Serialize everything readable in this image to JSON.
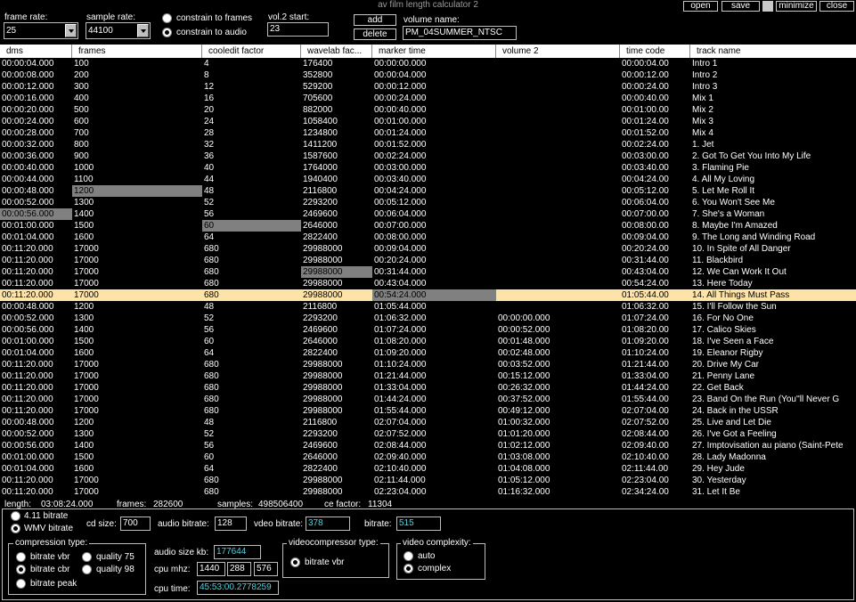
{
  "window": {
    "title": "av film length calculator 2",
    "buttons": {
      "open": "open",
      "save": "save",
      "minimize": "minimize",
      "close": "close"
    }
  },
  "toolbar": {
    "frame_rate_label": "frame rate:",
    "frame_rate_value": "25",
    "sample_rate_label": "sample rate:",
    "sample_rate_value": "44100",
    "constrain_frames": "constrain to frames",
    "constrain_audio": "constrain to audio",
    "vol2_start_label": "vol.2 start:",
    "vol2_start_value": "23",
    "add": "add",
    "delete": "delete",
    "volume_name_label": "volume name:",
    "volume_name_value": "PM_04SUMMER_NTSC"
  },
  "table": {
    "columns": [
      "dms",
      "frames",
      "cooledit factor",
      "wavelab fac...",
      "marker time",
      "volume 2",
      "time code",
      "track name"
    ],
    "rows": [
      [
        "00:00:04.000",
        "100",
        "4",
        "176400",
        "00:00:00.000",
        "",
        "00:00:04.00",
        "Intro 1"
      ],
      [
        "00:00:08.000",
        "200",
        "8",
        "352800",
        "00:00:04.000",
        "",
        "00:00:12.00",
        "Intro 2"
      ],
      [
        "00:00:12.000",
        "300",
        "12",
        "529200",
        "00:00:12.000",
        "",
        "00:00:24.00",
        "Intro 3"
      ],
      [
        "00:00:16.000",
        "400",
        "16",
        "705600",
        "00:00:24.000",
        "",
        "00:00:40.00",
        "Mix 1"
      ],
      [
        "00:00:20.000",
        "500",
        "20",
        "882000",
        "00:00:40.000",
        "",
        "00:01:00.00",
        "Mix 2"
      ],
      [
        "00:00:24.000",
        "600",
        "24",
        "1058400",
        "00:01:00.000",
        "",
        "00:01:24.00",
        "Mix 3"
      ],
      [
        "00:00:28.000",
        "700",
        "28",
        "1234800",
        "00:01:24.000",
        "",
        "00:01:52.00",
        "Mix 4"
      ],
      [
        "00:00:32.000",
        "800",
        "32",
        "1411200",
        "00:01:52.000",
        "",
        "00:02:24.00",
        "1. Jet"
      ],
      [
        "00:00:36.000",
        "900",
        "36",
        "1587600",
        "00:02:24.000",
        "",
        "00:03:00.00",
        "2. Got To Get You Into My Life"
      ],
      [
        "00:00:40.000",
        "1000",
        "40",
        "1764000",
        "00:03:00.000",
        "",
        "00:03:40.00",
        "3. Flaming Pie"
      ],
      [
        "00:00:44.000",
        "1100",
        "44",
        "1940400",
        "00:03:40.000",
        "",
        "00:04:24.00",
        "4. All My Loving"
      ],
      [
        "00:00:48.000",
        "1200",
        "48",
        "2116800",
        "00:04:24.000",
        "",
        "00:05:12.00",
        "5. Let Me Roll It"
      ],
      [
        "00:00:52.000",
        "1300",
        "52",
        "2293200",
        "00:05:12.000",
        "",
        "00:06:04.00",
        "6. You Won't See Me"
      ],
      [
        "00:00:56.000",
        "1400",
        "56",
        "2469600",
        "00:06:04.000",
        "",
        "00:07:00.00",
        "7. She's a Woman"
      ],
      [
        "00:01:00.000",
        "1500",
        "60",
        "2646000",
        "00:07:00.000",
        "",
        "00:08:00.00",
        "8. Maybe I'm Amazed"
      ],
      [
        "00:01:04.000",
        "1600",
        "64",
        "2822400",
        "00:08:00.000",
        "",
        "00:09:04.00",
        "9. The Long and Winding Road"
      ],
      [
        "00:11:20.000",
        "17000",
        "680",
        "29988000",
        "00:09:04.000",
        "",
        "00:20:24.00",
        "10. In Spite of All Danger"
      ],
      [
        "00:11:20.000",
        "17000",
        "680",
        "29988000",
        "00:20:24.000",
        "",
        "00:31:44.00",
        "11. Blackbird"
      ],
      [
        "00:11:20.000",
        "17000",
        "680",
        "29988000",
        "00:31:44.000",
        "",
        "00:43:04.00",
        "12.  We Can Work It Out"
      ],
      [
        "00:11:20.000",
        "17000",
        "680",
        "29988000",
        "00:43:04.000",
        "",
        "00:54:24.00",
        "13. Here Today"
      ],
      [
        "00:11:20.000",
        "17000",
        "680",
        "29988000",
        "00:54:24.000",
        "",
        "01:05:44.00",
        "14. All Things Must Pass"
      ],
      [
        "00:00:48.000",
        "1200",
        "48",
        "2116800",
        "01:05:44.000",
        "",
        "01:06:32.00",
        "15. I'll Follow the Sun"
      ],
      [
        "00:00:52.000",
        "1300",
        "52",
        "2293200",
        "01:06:32.000",
        "00:00:00.000",
        "01:07:24.00",
        "16. For No One"
      ],
      [
        "00:00:56.000",
        "1400",
        "56",
        "2469600",
        "01:07:24.000",
        "00:00:52.000",
        "01:08:20.00",
        "17. Calico Skies"
      ],
      [
        "00:01:00.000",
        "1500",
        "60",
        "2646000",
        "01:08:20.000",
        "00:01:48.000",
        "01:09:20.00",
        "18. I've Seen a Face"
      ],
      [
        "00:01:04.000",
        "1600",
        "64",
        "2822400",
        "01:09:20.000",
        "00:02:48.000",
        "01:10:24.00",
        "19. Eleanor Rigby"
      ],
      [
        "00:11:20.000",
        "17000",
        "680",
        "29988000",
        "01:10:24.000",
        "00:03:52.000",
        "01:21:44.00",
        "20. Drive My Car"
      ],
      [
        "00:11:20.000",
        "17000",
        "680",
        "29988000",
        "01:21:44.000",
        "00:15:12.000",
        "01:33:04.00",
        "21. Penny Lane"
      ],
      [
        "00:11:20.000",
        "17000",
        "680",
        "29988000",
        "01:33:04.000",
        "00:26:32.000",
        "01:44:24.00",
        "22. Get Back"
      ],
      [
        "00:11:20.000",
        "17000",
        "680",
        "29988000",
        "01:44:24.000",
        "00:37:52.000",
        "01:55:44.00",
        "23. Band On the Run (You''ll Never G"
      ],
      [
        "00:11:20.000",
        "17000",
        "680",
        "29988000",
        "01:55:44.000",
        "00:49:12.000",
        "02:07:04.00",
        "24. Back in the USSR"
      ],
      [
        "00:00:48.000",
        "1200",
        "48",
        "2116800",
        "02:07:04.000",
        "01:00:32.000",
        "02:07:52.00",
        "25. Live and Let Die"
      ],
      [
        "00:00:52.000",
        "1300",
        "52",
        "2293200",
        "02:07:52.000",
        "01:01:20.000",
        "02:08:44.00",
        "26. I've Got a Feeling"
      ],
      [
        "00:00:56.000",
        "1400",
        "56",
        "2469600",
        "02:08:44.000",
        "01:02:12.000",
        "02:09:40.00",
        "27. Imptovisation au piano (Saint-Pete"
      ],
      [
        "00:01:00.000",
        "1500",
        "60",
        "2646000",
        "02:09:40.000",
        "01:03:08.000",
        "02:10:40.00",
        "28. Lady Madonna"
      ],
      [
        "00:01:04.000",
        "1600",
        "64",
        "2822400",
        "02:10:40.000",
        "01:04:08.000",
        "02:11:44.00",
        "29. Hey Jude"
      ],
      [
        "00:11:20.000",
        "17000",
        "680",
        "29988000",
        "02:11:44.000",
        "01:05:12.000",
        "02:23:04.00",
        "30. Yesterday"
      ],
      [
        "00:11:20.000",
        "17000",
        "680",
        "29988000",
        "02:23:04.000",
        "01:16:32.000",
        "02:34:24.00",
        "31. Let It Be"
      ]
    ]
  },
  "status": {
    "length_label": "length:",
    "length_value": "03:08:24.000",
    "frames_label": "frames:",
    "frames_value": "282600",
    "samples_label": "samples:",
    "samples_value": "498506400",
    "ce_label": "ce factor:",
    "ce_value": "11304"
  },
  "bottom": {
    "bitrate_411": "4.11 bitrate",
    "wmv_bitrate": "WMV bitrate",
    "cd_size_label": "cd size:",
    "cd_size_value": "700",
    "audio_bitrate_label": "audio bitrate:",
    "audio_bitrate_value": "128",
    "video_bitrate_label": "vdeo bitrate:",
    "video_bitrate_value": "378",
    "bitrate_label": "bitrate:",
    "bitrate_value": "515",
    "compression_title": "compression type:",
    "bitrate_vbr": "bitrate vbr",
    "bitrate_cbr": "bitrate cbr",
    "bitrate_peak": "bitrate peak",
    "quality_75": "quality 75",
    "quality_98": "quality 98",
    "audio_size_label": "audio size kb:",
    "audio_size_value": "177644",
    "cpu_mhz_label": "cpu mhz:",
    "cpu_mhz_1": "1440",
    "cpu_mhz_2": "288",
    "cpu_mhz_3": "576",
    "cpu_time_label": "cpu time:",
    "cpu_time_value": "45:53:00.2778259",
    "videocompressor_title": "videocompressor type:",
    "videocompressor_vbr": "bitrate vbr",
    "complexity_title": "video complexity:",
    "auto": "auto",
    "complex": "complex"
  },
  "colors": {
    "selected_row": "#fde3a7",
    "cyan_text": "#4fd3e0",
    "highlight_cell": "#808080"
  }
}
